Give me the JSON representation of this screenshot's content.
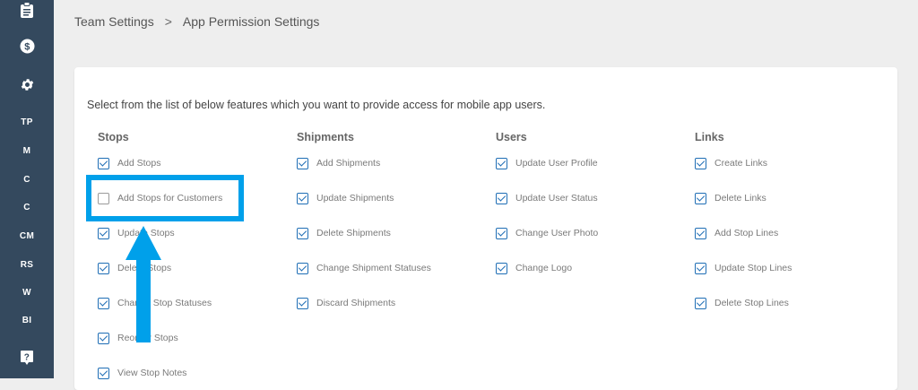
{
  "sidebar": {
    "icons": [
      {
        "name": "clipboard-icon"
      },
      {
        "name": "dollar-icon"
      },
      {
        "name": "gear-icon"
      }
    ],
    "items": [
      "TP",
      "M",
      "C",
      "C",
      "CM",
      "RS",
      "W",
      "BI"
    ],
    "bottom_icon": "help-icon"
  },
  "breadcrumb": {
    "parent": "Team Settings",
    "separator": ">",
    "current": "App Permission Settings"
  },
  "intro": "Select from the list of below features which you want to provide access for mobile app users.",
  "columns": [
    {
      "title": "Stops",
      "options": [
        {
          "label": "Add Stops",
          "checked": true
        },
        {
          "label": "Add Stops for Customers",
          "checked": false
        },
        {
          "label": "Update Stops",
          "checked": true
        },
        {
          "label": "Delete Stops",
          "checked": true
        },
        {
          "label": "Change Stop Statuses",
          "checked": true
        },
        {
          "label": "Reorder Stops",
          "checked": true
        },
        {
          "label": "View Stop Notes",
          "checked": true
        }
      ]
    },
    {
      "title": "Shipments",
      "options": [
        {
          "label": "Add Shipments",
          "checked": true
        },
        {
          "label": "Update Shipments",
          "checked": true
        },
        {
          "label": "Delete Shipments",
          "checked": true
        },
        {
          "label": "Change Shipment Statuses",
          "checked": true
        },
        {
          "label": "Discard Shipments",
          "checked": true
        }
      ]
    },
    {
      "title": "Users",
      "options": [
        {
          "label": "Update User Profile",
          "checked": true
        },
        {
          "label": "Update User Status",
          "checked": true
        },
        {
          "label": "Change User Photo",
          "checked": true
        },
        {
          "label": "Change Logo",
          "checked": true
        }
      ]
    },
    {
      "title": "Links",
      "options": [
        {
          "label": "Create Links",
          "checked": true
        },
        {
          "label": "Delete Links",
          "checked": true
        },
        {
          "label": "Add Stop Lines",
          "checked": true
        },
        {
          "label": "Update Stop Lines",
          "checked": true
        },
        {
          "label": "Delete Stop Lines",
          "checked": true
        }
      ]
    }
  ],
  "colors": {
    "sidebar": "#34495e",
    "checkbox": "#1f6eb5",
    "annotation": "#00a0ea"
  }
}
